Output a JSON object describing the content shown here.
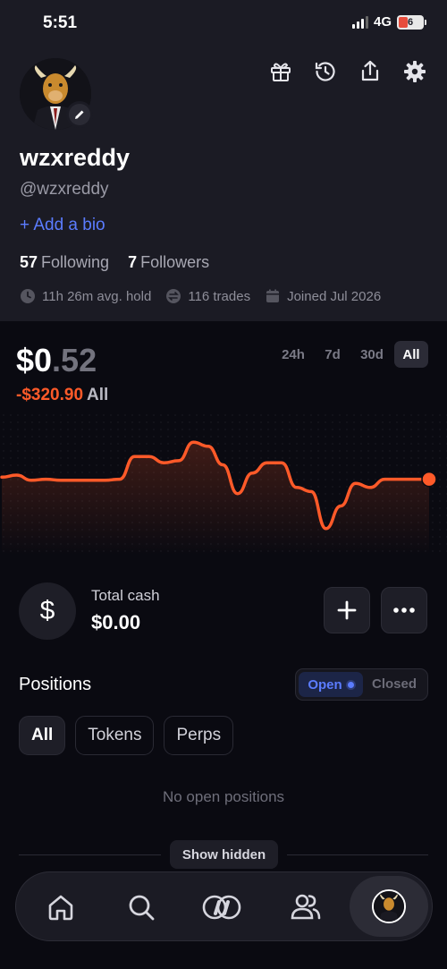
{
  "status_bar": {
    "time": "5:51",
    "network": "4G",
    "battery": "6"
  },
  "profile": {
    "username": "wzxreddy",
    "handle": "@wzxreddy",
    "add_bio": "+ Add a bio",
    "following_count": "57",
    "following_label": "Following",
    "followers_count": "7",
    "followers_label": "Followers",
    "stats": {
      "avg_hold": "11h 26m avg. hold",
      "trades": "116 trades",
      "joined": "Joined Jul 2026"
    }
  },
  "portfolio": {
    "balance_int": "$0",
    "balance_dec": ".52",
    "pnl": "-$320.90",
    "pnl_period": "All",
    "ranges": [
      "24h",
      "7d",
      "30d",
      "All"
    ],
    "active_range": "All",
    "colors": {
      "line": "#ff5a29",
      "fill_top": "#3a1a12"
    }
  },
  "chart_data": {
    "type": "line",
    "series": [
      {
        "values": [
          0.58,
          0.6,
          0.55,
          0.56,
          0.55,
          0.55,
          0.55,
          0.55,
          0.56,
          0.78,
          0.78,
          0.72,
          0.74,
          0.92,
          0.88,
          0.7,
          0.42,
          0.62,
          0.72,
          0.72,
          0.48,
          0.44,
          0.08,
          0.3,
          0.52,
          0.48,
          0.56,
          0.56,
          0.56,
          0.56
        ]
      }
    ]
  },
  "cash": {
    "label": "Total cash",
    "value": "$0.00"
  },
  "positions": {
    "title": "Positions",
    "toggle_open": "Open",
    "toggle_closed": "Closed",
    "chips": [
      "All",
      "Tokens",
      "Perps"
    ],
    "empty_text": "No open positions",
    "show_hidden": "Show hidden"
  },
  "icons": {
    "gift": "gift-icon",
    "history": "history-icon",
    "share": "share-icon",
    "settings": "gear-icon",
    "home": "home-icon",
    "search": "search-icon",
    "trade": "trade-icon",
    "people": "people-icon"
  }
}
